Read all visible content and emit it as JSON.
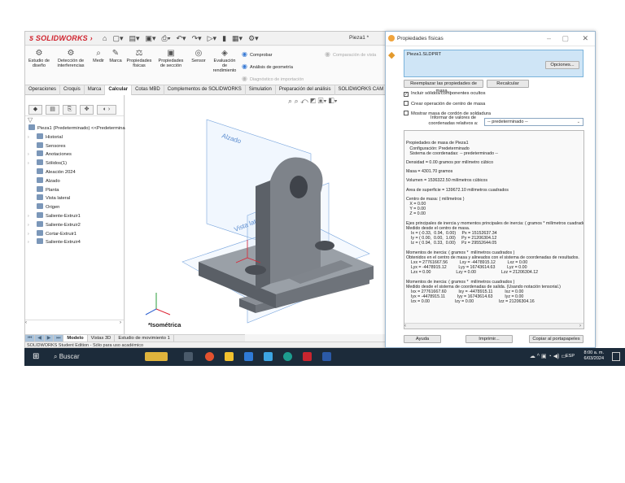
{
  "app": {
    "brand": "SOLIDWORKS",
    "document_title": "Pieza1 *"
  },
  "ribbon": {
    "buttons": [
      {
        "label": "Estudio de diseño",
        "icon": "design-study-icon"
      },
      {
        "label": "Detección de interferencias",
        "icon": "interference-icon"
      },
      {
        "label": "Medir",
        "icon": "measure-icon"
      },
      {
        "label": "Marca",
        "icon": "markup-icon"
      },
      {
        "label": "Propiedades físicas",
        "icon": "mass-properties-icon"
      },
      {
        "label": "Propiedades de sección",
        "icon": "section-properties-icon"
      },
      {
        "label": "Sensor",
        "icon": "sensor-icon"
      },
      {
        "label": "Evaluación de rendimiento",
        "icon": "performance-icon"
      }
    ],
    "check": "Comprobar",
    "geometry": "Análisis de geometría",
    "import_diag": "Diagnóstico de importación",
    "compare": "Comparación de vista"
  },
  "command_tabs": [
    "Operaciones",
    "Croquis",
    "Marca",
    "Calcular",
    "Cotas MBD",
    "Complementos de SOLIDWORKS",
    "Simulation",
    "Preparación del análisis",
    "SOLIDWORKS CAM"
  ],
  "active_command_tab": "Calcular",
  "tree": {
    "items": [
      {
        "label": "Pieza1 (Predeterminado) <<Predeterminado>",
        "root": true,
        "exp": ""
      },
      {
        "label": "Historial",
        "exp": "›"
      },
      {
        "label": "Sensores",
        "exp": ""
      },
      {
        "label": "Anotaciones",
        "exp": "›"
      },
      {
        "label": "Sólidos(1)",
        "exp": "›"
      },
      {
        "label": "Aleación 2024",
        "exp": ""
      },
      {
        "label": "Alzado",
        "exp": ""
      },
      {
        "label": "Planta",
        "exp": ""
      },
      {
        "label": "Vista lateral",
        "exp": ""
      },
      {
        "label": "Origen",
        "exp": ""
      },
      {
        "label": "Saliente-Extruir1",
        "exp": "›"
      },
      {
        "label": "Saliente-Extruir2",
        "exp": "›"
      },
      {
        "label": "Cortar-Extruir1",
        "exp": "›"
      },
      {
        "label": "Saliente-Extruir4",
        "exp": "›"
      }
    ]
  },
  "model_tabs": [
    "Modelo",
    "Vistas 3D",
    "Estudio de movimiento 1"
  ],
  "active_model_tab": "Modelo",
  "status_bar": "SOLIDWORKS Student Edition - Sólo para uso académico",
  "viewport": {
    "view_label": "*Isométrica",
    "plane_front": "Alzado",
    "plane_side": "Vista lateral",
    "plane_top": "Planta"
  },
  "dialog": {
    "title": "Propiedades físicas",
    "selection": "Pieza1.SLDPRT",
    "options_button": "Opciones...",
    "override_button": "Reemplazar las propiedades de masa...",
    "recalc_button": "Recalcular",
    "chk_hidden": "Incluir sólidos/componentes ocultos",
    "chk_com": "Crear operación de centro de masa",
    "chk_weld": "Mostrar masa de cordón de soldadura",
    "relative_label": "Informar de valores de coordenadas relativos a:",
    "relative_value": "-- predeterminado --",
    "results": [
      "Propiedades de masa de Pieza1\n   Configuración: Predeterminado\n   Sistema de coordenadas: -- predeterminado --",
      "Densidad = 0.00 gramos por milímetro cúbico",
      "Masa = 4301.70 gramos",
      "Volumen = 1536322.50 milímetros cúbicos",
      "Área de superficie = 139672.10 milímetros cuadrados",
      "Centro de masa: ( milímetros )\n   X = 0.00\n   Y = 0.00\n   Z = 0.00",
      "Ejes principales de inercia y momentos principales de inercia: ( gramos * milímetros cuadrados )\nMedido desde el centro de masa.\n    Ix = (-0.33,  0.94,  0.00)     Px = 15152637.34\n    Iy = ( 0.00,  0.00,  1.00)     Py = 21206304.12\n    Iz = ( 0.94,  0.33,  0.00)     Pz = 29552644.05",
      "Momentos de inercia: ( gramos *  milímetros cuadrados )\nObtenidos en el centro de masa y alineados con el sistema de coordenadas de resultados.\n    Lxx = 27761667.56          Lxy = -4478915.12          Lxz = 0.00\n    Lyx = -4478915.12          Lyy = 16743614.63          Lyz = 0.00\n    Lzx = 0.00                     Lzy = 0.00                     Lzz = 21206304.12",
      "Momentos de inercia: ( gramos *  milímetros cuadrados )\nMedido desde el sistema de coordenadas de salida. (Usando notación tensorial.)\n    Ixx = 27761667.60          Ixy = -4478915.11          Ixz = 0.00\n    Iyx = -4478915.11          Iyy = 16743614.63          Iyz = 0.00\n    Izx = 0.00                     Izy = 0.00                     Izz = 21206304.16"
    ],
    "help_button": "Ayuda",
    "print_button": "Imprimir...",
    "copy_button": "Copiar al portapapeles"
  },
  "taskbar": {
    "search_placeholder": "Buscar",
    "time": "8:00 a. m.",
    "date": "6/03/2024",
    "lang": "ESP"
  }
}
